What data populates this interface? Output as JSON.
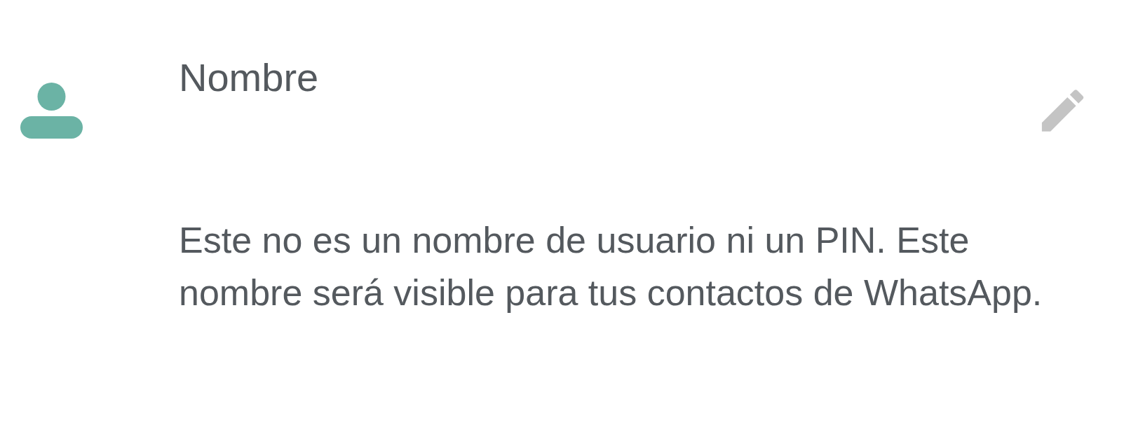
{
  "name_row": {
    "label": "Nombre"
  },
  "hint": "Este no es un nombre de usuario ni un PIN. Este nombre será visible para tus contactos de WhatsApp."
}
